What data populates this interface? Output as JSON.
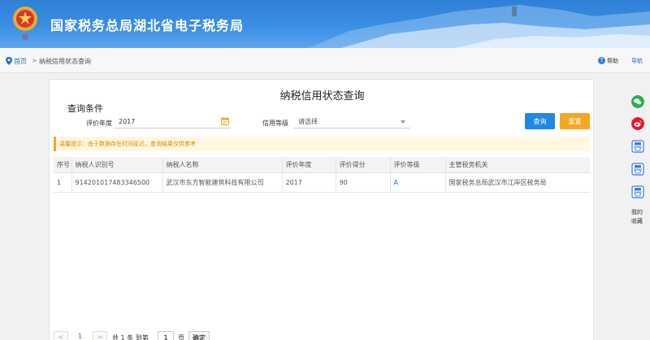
{
  "header": {
    "title": "国家税务总局湖北省电子税务局"
  },
  "breadcrumb": {
    "home": "首页",
    "separator": ">",
    "current": "纳税信用状态查询"
  },
  "topright": {
    "help_icon": "?",
    "help": "帮助",
    "nav": "导航"
  },
  "main": {
    "title": "纳税信用状态查询",
    "conditions_title": "查询条件",
    "year_label": "评价年度",
    "year_value": "2017",
    "level_label": "信用等级",
    "level_value": "请选择",
    "query_button": "查询",
    "reset_button": "重置",
    "tip": "温馨提示：由于数据存在时间延迟，查询结果仅供参考"
  },
  "table": {
    "headers": [
      "序号",
      "纳税人识别号",
      "纳税人名称",
      "评价年度",
      "评价得分",
      "评价等级",
      "主管税务机关"
    ],
    "rows": [
      [
        "1",
        "914201017483346500",
        "武汉市东方智能建筑科技有限公司",
        "2017",
        "90",
        "A",
        "国家税务总局武汉市江岸区税务局"
      ]
    ]
  },
  "pager": {
    "prev": "<",
    "page": "1",
    "next": ">",
    "summary": "共 1 条 到第",
    "goto_value": "1",
    "page_unit": "页",
    "go_button": "确定"
  },
  "sidebar": {
    "bottom_label": "我的 收藏"
  },
  "colors": {
    "header_blue": "#3a8ee4",
    "query_button": "#1e88e5",
    "reset_button": "#f5a623",
    "tip_text": "#e08a00",
    "link_blue": "#2a6fc9",
    "wechat_green": "#2bb24c",
    "weibo_red": "#e6162d"
  },
  "icons": {
    "emblem": "tax-emblem-icon",
    "location": "location-pin-icon",
    "calendar": "calendar-icon",
    "dropdown": "chevron-down-icon",
    "wechat": "wechat-icon",
    "weibo": "weibo-icon",
    "print": "print-icon"
  }
}
